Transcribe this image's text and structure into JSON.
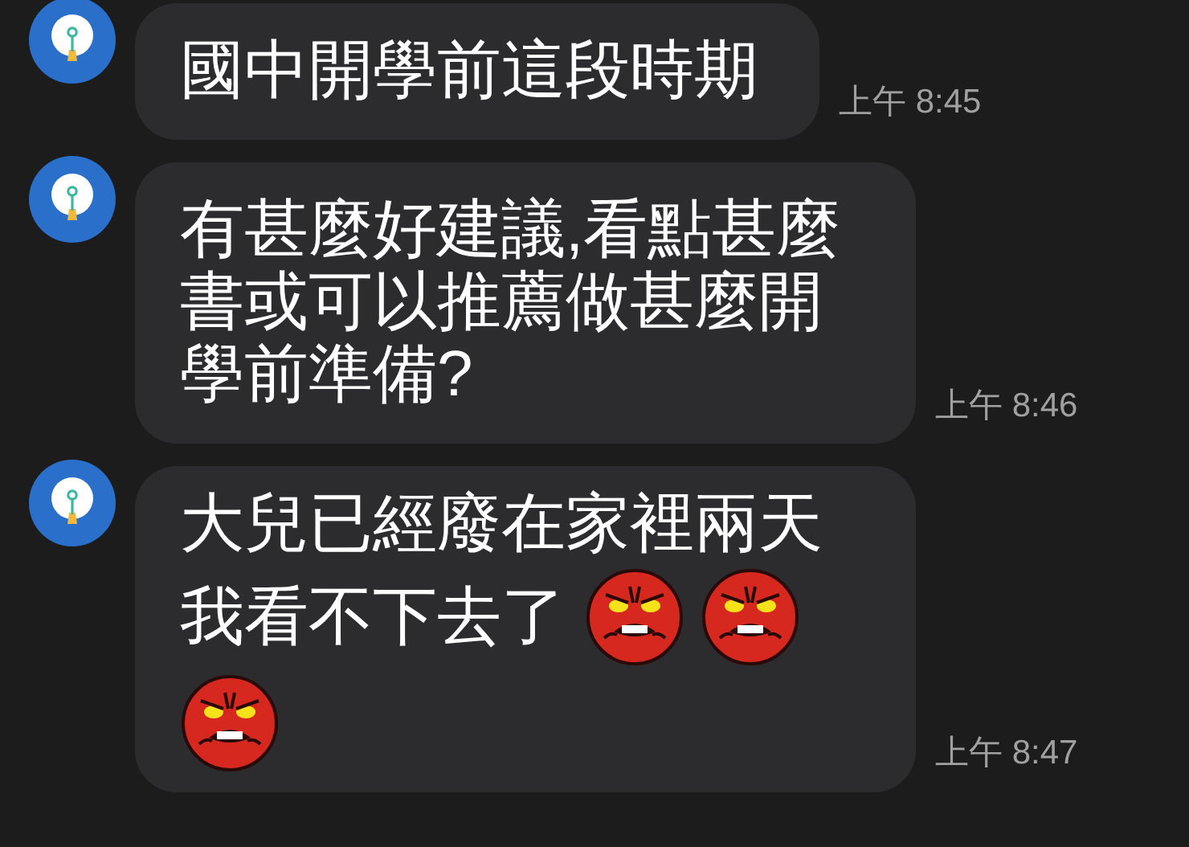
{
  "messages": [
    {
      "parts": [
        {
          "kind": "text",
          "text": "國中開學前這段時期"
        }
      ],
      "time": "上午 8:45"
    },
    {
      "parts": [
        {
          "kind": "text",
          "text": "有甚麼好建議,看點甚麼書或可以推薦做甚麼開學前準備?"
        }
      ],
      "time": "上午 8:46"
    },
    {
      "parts": [
        {
          "kind": "text",
          "text": "大兒已經廢在家裡兩天"
        },
        {
          "kind": "text",
          "text": "我看不下去了"
        },
        {
          "kind": "sticker"
        },
        {
          "kind": "sticker"
        },
        {
          "kind": "sticker"
        }
      ],
      "time": "上午 8:47"
    }
  ]
}
